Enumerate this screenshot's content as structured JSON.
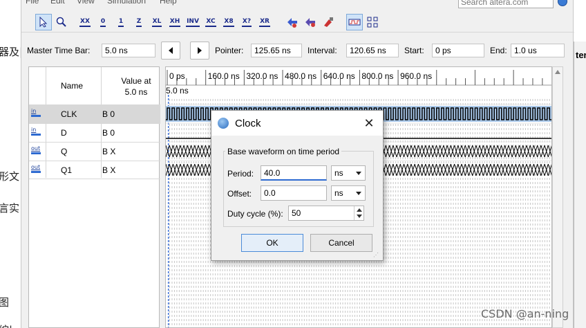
{
  "background_text": {
    "line1": "器及|",
    "line2": "形文",
    "line3": "言实",
    "line4": "图",
    "line5": "综|"
  },
  "menubar": {
    "items": [
      "File",
      "Edit",
      "View",
      "Simulation",
      "Help"
    ],
    "search_placeholder": "Search altera.com"
  },
  "timebar": {
    "master_label": "Master Time Bar:",
    "master_value": "5.0 ns",
    "pointer_label": "Pointer:",
    "pointer_value": "125.65 ns",
    "interval_label": "Interval:",
    "interval_value": "120.65 ns",
    "start_label": "Start:",
    "start_value": "0 ps",
    "end_label": "End:",
    "end_value": "1.0 us"
  },
  "signals": {
    "header_name": "Name",
    "header_value_line1": "Value at",
    "header_value_line2": "5.0 ns",
    "rows": [
      {
        "dir": "in",
        "name": "CLK",
        "value": "B 0"
      },
      {
        "dir": "in",
        "name": "D",
        "value": "B 0"
      },
      {
        "dir": "out",
        "name": "Q",
        "value": "B X"
      },
      {
        "dir": "out",
        "name": "Q1",
        "value": "B X"
      }
    ]
  },
  "waveform": {
    "ruler": [
      "0 ps",
      "160.0 ns",
      "320.0 ns",
      "480.0 ns",
      "640.0 ns",
      "800.0 ns",
      "960.0 ns"
    ],
    "cursor_label": "5.0 ns"
  },
  "dialog": {
    "title": "Clock",
    "group_label": "Base waveform on time period",
    "period_label": "Period:",
    "period_value": "40.0",
    "period_unit": "ns",
    "offset_label": "Offset:",
    "offset_value": "0.0",
    "offset_unit": "ns",
    "duty_label": "Duty cycle (%):",
    "duty_value": "50",
    "ok_label": "OK",
    "cancel_label": "Cancel"
  },
  "right_panel": {
    "fragment": "ter"
  },
  "watermark": "CSDN @an-ning",
  "colors": {
    "clk_band": "#a9c8ea",
    "selected_row": "#d8d8d8",
    "accent": "#2d6ad1"
  }
}
